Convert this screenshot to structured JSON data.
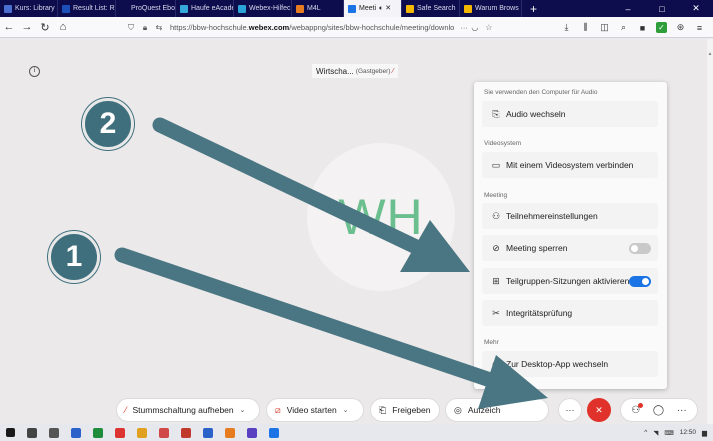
{
  "browser": {
    "tabs": [
      {
        "label": "Kurs: Library a",
        "color": "#4a6fd0"
      },
      {
        "label": "Result List: R",
        "color": "#1d4fb8"
      },
      {
        "label": "ProQuest Ebook C",
        "color": "#0d0d4d"
      },
      {
        "label": "Haufe eAcade",
        "color": "#35a7d9"
      },
      {
        "label": "Webex-Hilfec",
        "color": "#2aa3d6"
      },
      {
        "label": "M4L",
        "color": "#e77b20"
      },
      {
        "label": "Meeti",
        "color": "#1a74e6",
        "active": true
      },
      {
        "label": "Safe Search",
        "color": "#f5b800"
      },
      {
        "label": "Warum Brows",
        "color": "#f5b800"
      }
    ],
    "new_tab": "+",
    "window_controls": [
      "–",
      "□",
      "✕"
    ],
    "url_prefix": "https://bbw-hochschule.",
    "url_domain": "webex.com",
    "url_suffix": "/webappng/sites/bbw-hochschule/meeting/downlo",
    "url_more": "···"
  },
  "meeting": {
    "title": "Wirtscha...",
    "host_label": "(Gastgeber)",
    "avatar_initials": "WH"
  },
  "menu": {
    "sections": {
      "audio": "Sie verwenden den Computer für Audio",
      "video_system": "Videosystem",
      "meeting": "Meeting",
      "more": "Mehr"
    },
    "items": {
      "switch_audio": "Audio wechseln",
      "connect_video_system": "Mit einem Videosystem verbinden",
      "participant_settings": "Teilnehmereinstellungen",
      "lock_meeting": "Meeting sperren",
      "breakout_sessions": "Teilgruppen-Sitzungen aktivieren",
      "integrity_check": "Integritätsprüfung",
      "switch_desktop_app": "Zur Desktop-App wechseln"
    },
    "lock_meeting_on": false,
    "breakout_sessions_on": true
  },
  "controls": {
    "unmute": "Stummschaltung aufheben",
    "start_video": "Video starten",
    "share": "Freigeben",
    "record": "Aufzeich",
    "more": "···",
    "end": "✕"
  },
  "annotations": {
    "badge_1": "1",
    "badge_2": "2"
  },
  "taskbar": {
    "time": "12:50",
    "icon_colors": [
      "#1a1a1a",
      "#444",
      "#555",
      "#2b62c9",
      "#1e8c3a",
      "#d33",
      "#e0a020",
      "#d04848",
      "#c0392b",
      "#2b62c9",
      "#e77b20",
      "#5a3fc0",
      "#1a74e6"
    ]
  }
}
